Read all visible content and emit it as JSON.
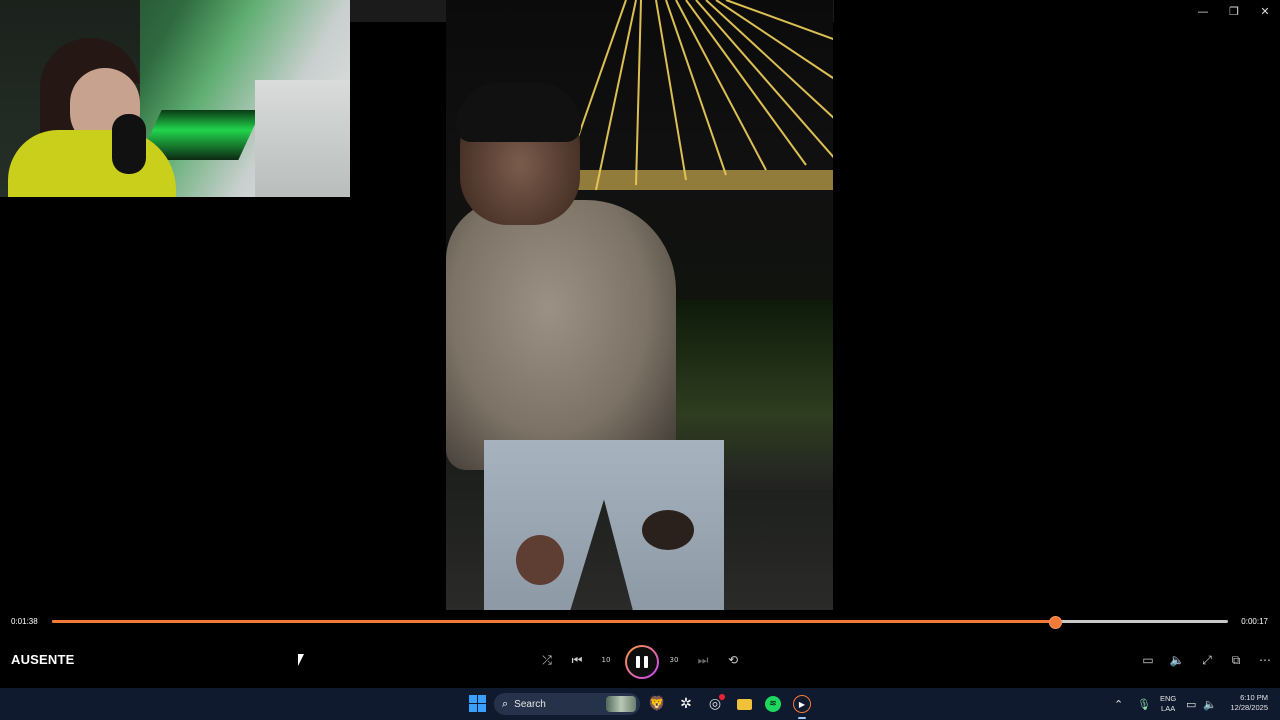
{
  "window": {
    "minimize_glyph": "—",
    "restore_glyph": "❐",
    "close_glyph": "✕"
  },
  "player": {
    "media_title": "AUSENTE",
    "elapsed_time": "0:01:38",
    "remaining_time": "0:00:17",
    "progress_fraction": 0.852,
    "accent_color": "#f07a36",
    "controls": [
      {
        "name": "shuffle-button",
        "icon": "shuffle-icon",
        "glyph": "⤮",
        "enabled": true
      },
      {
        "name": "previous-button",
        "icon": "skip-previous-icon",
        "glyph": "⏮",
        "enabled": true
      },
      {
        "name": "skip-back-button",
        "icon": "rewind-10-icon",
        "glyph": "10",
        "enabled": true
      },
      {
        "name": "skip-forward-button",
        "icon": "forward-30-icon",
        "glyph": "30",
        "enabled": true
      },
      {
        "name": "next-button",
        "icon": "skip-next-icon",
        "glyph": "⏭",
        "enabled": false
      },
      {
        "name": "repeat-button",
        "icon": "repeat-off-icon",
        "glyph": "⟲",
        "enabled": true
      }
    ],
    "right_controls": [
      {
        "name": "captions-button",
        "icon": "captions-icon",
        "glyph": "▭"
      },
      {
        "name": "volume-button",
        "icon": "volume-icon",
        "glyph": "🔈"
      },
      {
        "name": "fullscreen-button",
        "icon": "fullscreen-icon",
        "glyph": "⤢"
      },
      {
        "name": "mini-player-button",
        "icon": "mini-player-icon",
        "glyph": "⧉"
      },
      {
        "name": "more-options-button",
        "icon": "more-icon",
        "glyph": "⋯"
      }
    ]
  },
  "taskbar": {
    "search_placeholder": "Search",
    "search_icon": "magnifier-icon",
    "apps": [
      "brave-icon",
      "chatgpt-icon",
      "steam-icon",
      "file-explorer-icon",
      "spotify-icon",
      "media-player-icon"
    ],
    "tray": {
      "language_line1": "ENG",
      "language_line2": "LAA",
      "time": "6:10 PM",
      "date": "12/28/2025"
    }
  }
}
